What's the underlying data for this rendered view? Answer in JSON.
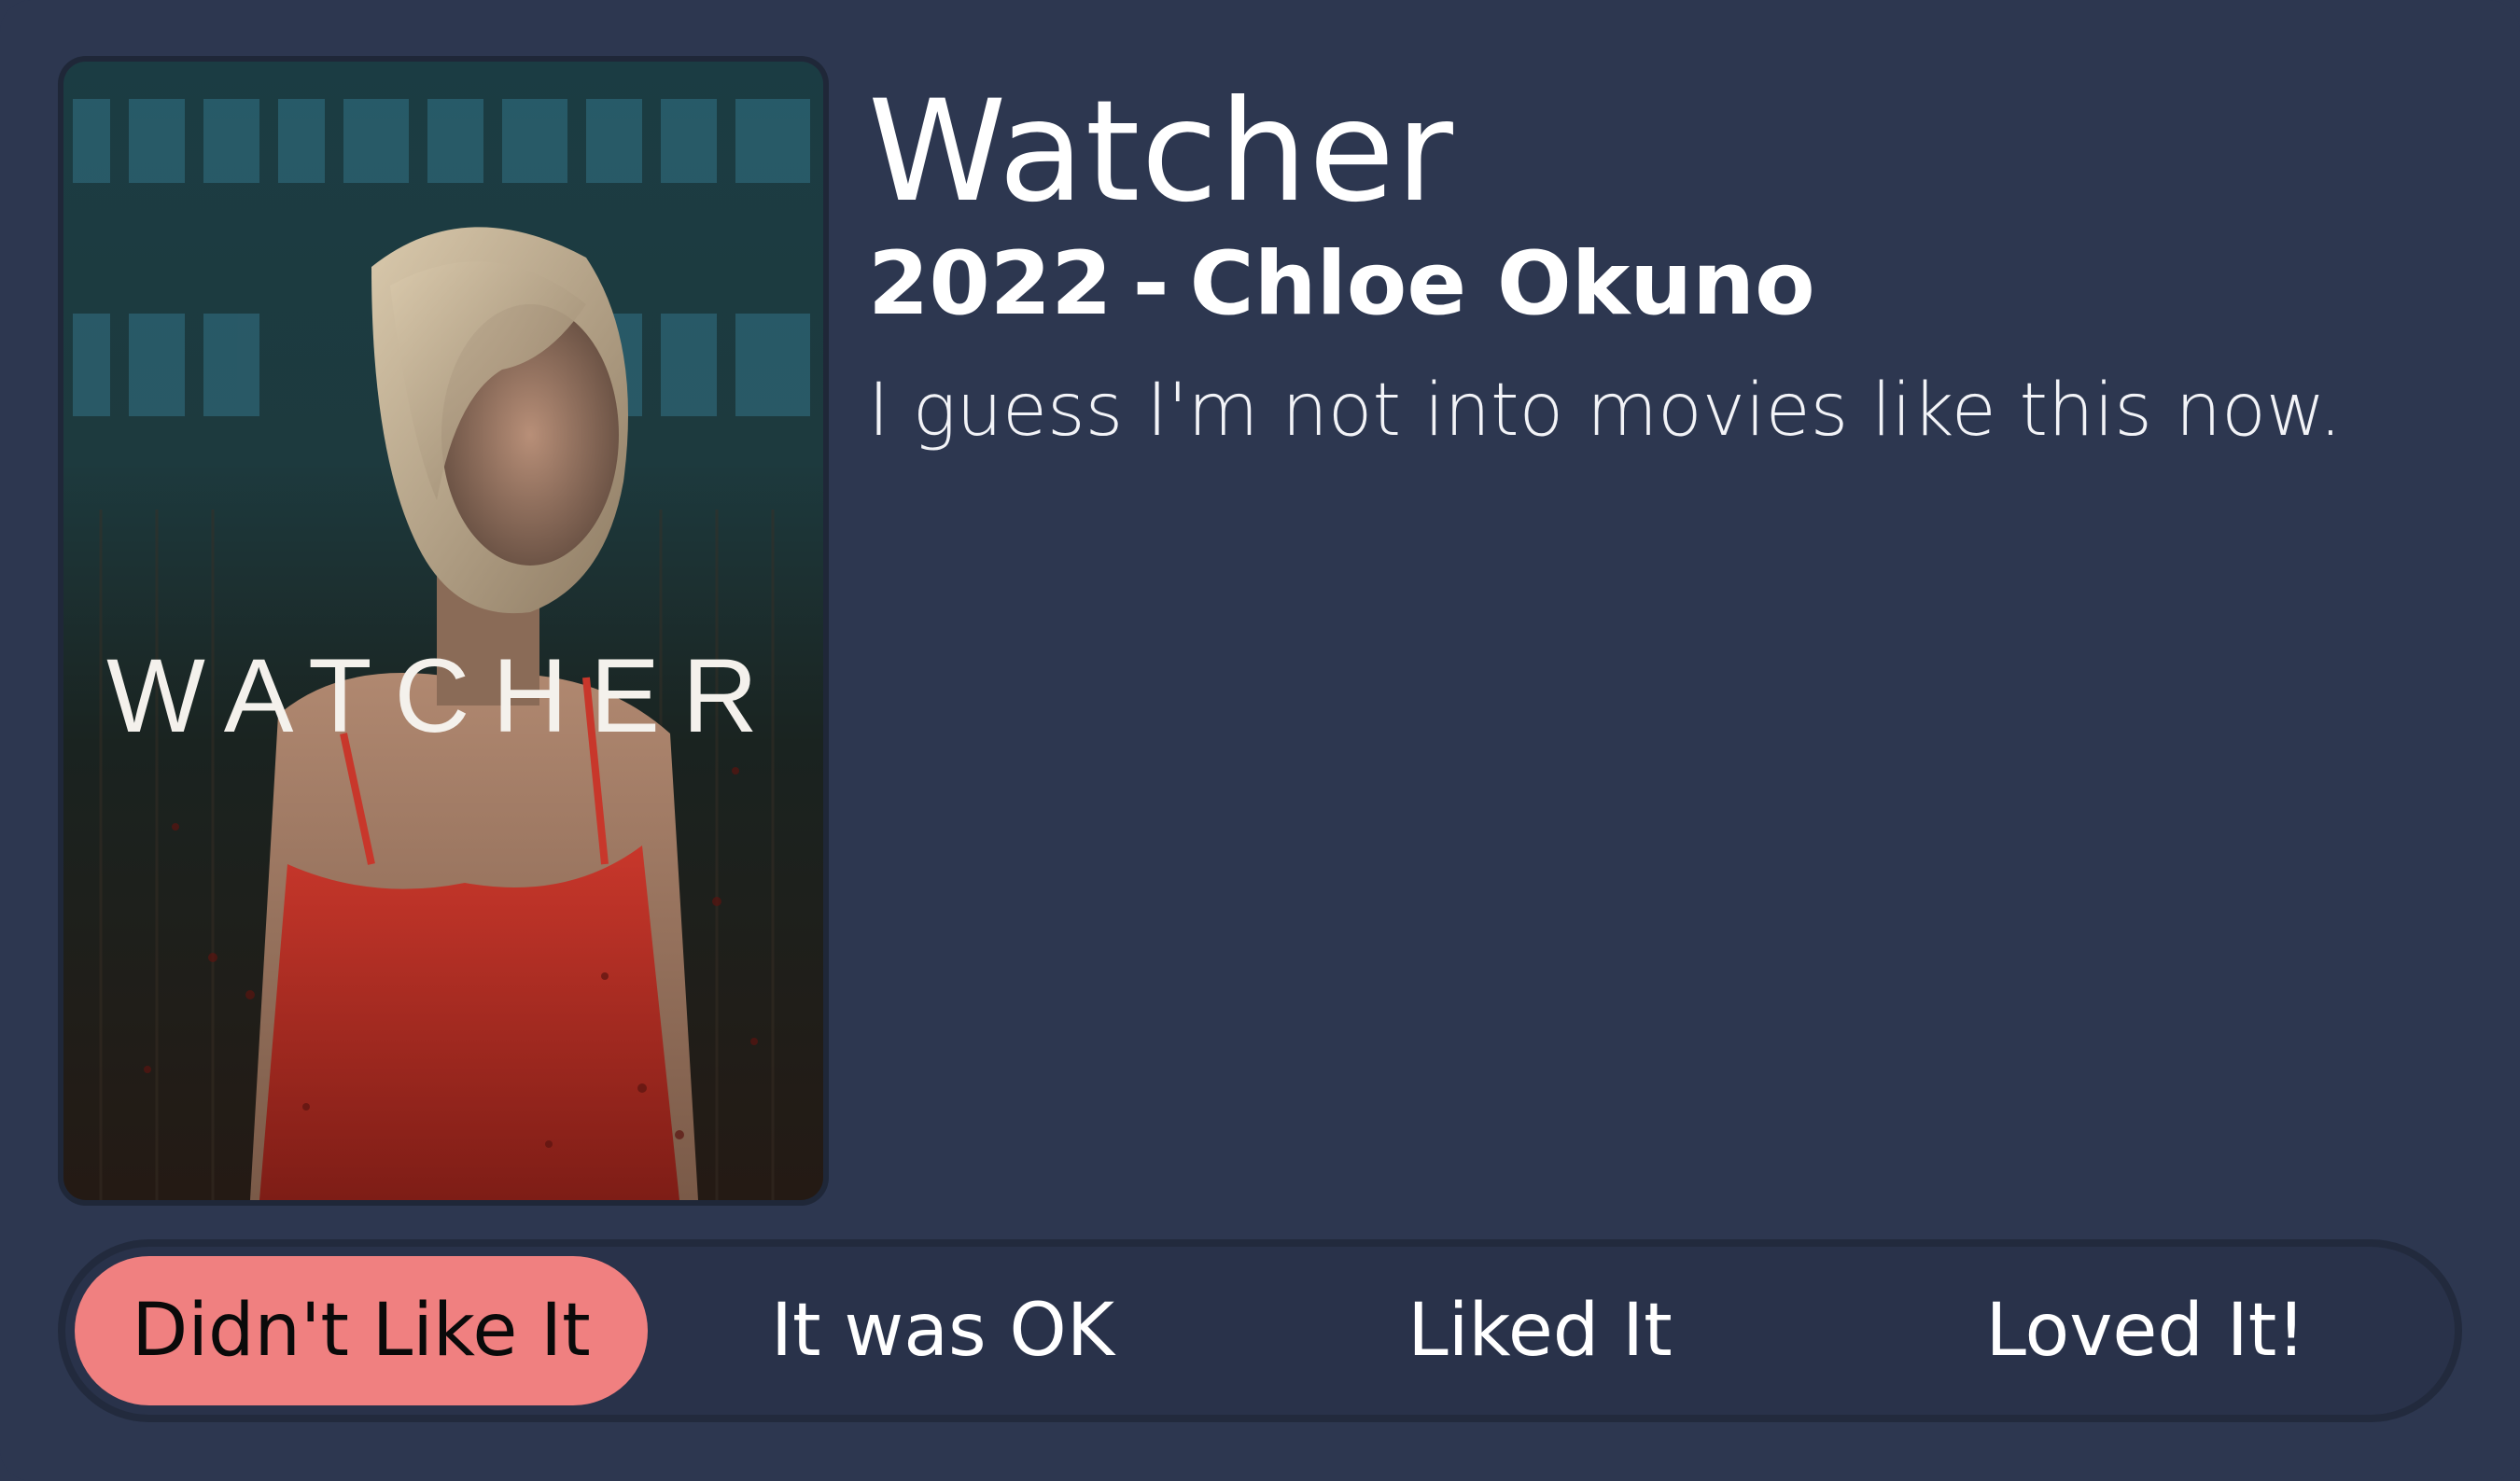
{
  "movie": {
    "title": "Watcher",
    "year": "2022",
    "separator": "-",
    "director": "Chloe Okuno",
    "review": "I guess I'm not into movies like this now.",
    "poster_title": "WATCHER"
  },
  "rating": {
    "options": [
      "Didn't Like It",
      "It was OK",
      "Liked It",
      "Loved It!"
    ],
    "selected_index": 0
  },
  "colors": {
    "background": "#2d3750",
    "selected": "#f08080",
    "bar_border": "#222a3d"
  }
}
